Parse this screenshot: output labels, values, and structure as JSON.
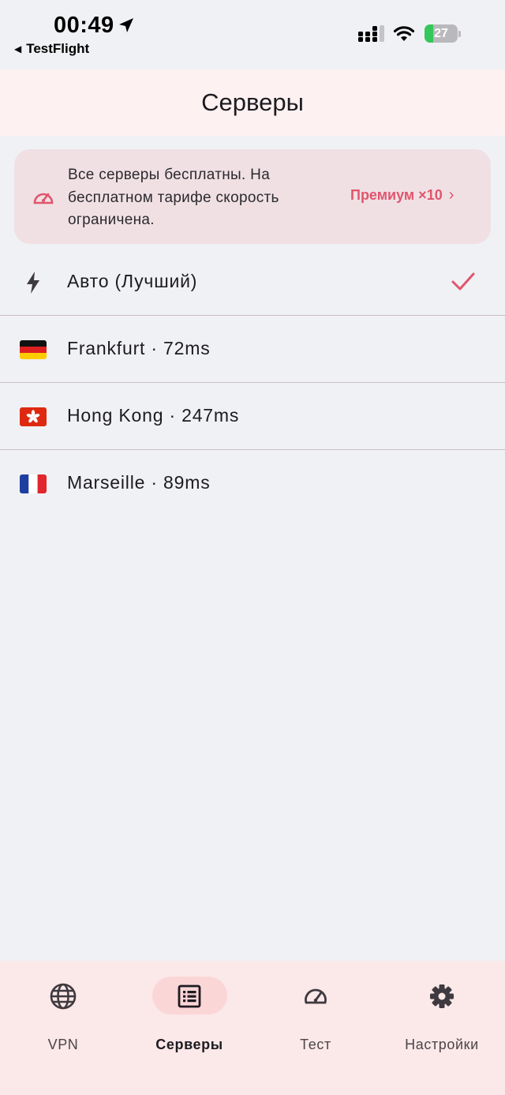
{
  "status_bar": {
    "time": "00:49",
    "back_label": "TestFlight",
    "battery_level": "27",
    "battery_percent": 27,
    "icons": [
      "location-arrow-icon",
      "cellular-signal-icon",
      "wifi-icon",
      "battery-icon"
    ]
  },
  "header": {
    "title": "Серверы"
  },
  "banner": {
    "text": "Все серверы бесплатны. На бесплатном тарифе скорость ограничена.",
    "action_label": "Премиум ×10",
    "icon": "speedometer-icon"
  },
  "servers": [
    {
      "label": "Авто (Лучший)",
      "icon": "bolt-icon",
      "selected": true
    },
    {
      "label": "Frankfurt · 72ms",
      "icon": "flag-de-icon",
      "selected": false
    },
    {
      "label": "Hong Kong · 247ms",
      "icon": "flag-hk-icon",
      "selected": false
    },
    {
      "label": "Marseille · 89ms",
      "icon": "flag-fr-icon",
      "selected": false
    }
  ],
  "nav": {
    "items": [
      {
        "label": "VPN",
        "icon": "globe-icon",
        "active": false
      },
      {
        "label": "Серверы",
        "icon": "list-icon",
        "active": true
      },
      {
        "label": "Тест",
        "icon": "speedometer-icon",
        "active": false
      },
      {
        "label": "Настройки",
        "icon": "gear-icon",
        "active": false
      }
    ]
  },
  "colors": {
    "accent": "#e0566d",
    "app_bar": "#fdf1f1",
    "banner_bg": "#f0e0e4",
    "nav_bg": "#fbe8e9",
    "nav_active_pill": "#fbd6d7",
    "battery_green": "#34c759"
  }
}
